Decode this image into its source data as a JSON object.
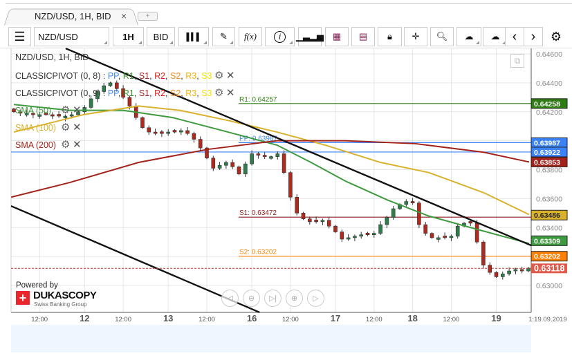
{
  "tab": {
    "title": "NZD/USD, 1H, BID",
    "close": "×",
    "new_tab": "+"
  },
  "toolbar": {
    "instrument": "NZD/USD",
    "period": "1H",
    "side": "BID",
    "fx": "f(x)",
    "info": "i"
  },
  "legend": {
    "title": "NZD/USD, 1H, BID",
    "pivots": [
      {
        "label": "CLASSICPIVOT (0, 8)"
      },
      {
        "label": "CLASSICPIVOT (0, 9)"
      }
    ],
    "pivot_levels": [
      {
        "t": "PP",
        "c": "#3b82f6"
      },
      {
        "t": "R1",
        "c": "#3a8a2a"
      },
      {
        "t": "S1",
        "c": "#b22222"
      },
      {
        "t": "R2",
        "c": "#e21b1b"
      },
      {
        "t": "S2",
        "c": "#f28a1a"
      },
      {
        "t": "R3",
        "c": "#f0b400"
      },
      {
        "t": "S3",
        "c": "#f4e200"
      }
    ],
    "smas": [
      {
        "label": "SMA (50)",
        "color": "#3e9a3e"
      },
      {
        "label": "SMA (100)",
        "color": "#d9b12b"
      },
      {
        "label": "SMA (200)",
        "color": "#a3231b"
      }
    ]
  },
  "branding": {
    "powered_by": "Powered by",
    "logo": "DUKASCOPY",
    "tagline": "Swiss Banking Group"
  },
  "chart_data": {
    "type": "candlestick",
    "title": "NZD/USD, 1H, BID",
    "ylim": [
      0.629,
      0.6465
    ],
    "y_ticks": [
      "0.64600",
      "0.64400",
      "0.64200",
      "0.64000",
      "0.63800",
      "0.63600",
      "0.63400",
      "0.63200",
      "0.63000"
    ],
    "y_tick_values": [
      0.646,
      0.644,
      0.642,
      0.64,
      0.638,
      0.636,
      0.634,
      0.632,
      0.63
    ],
    "x_ticks": [
      {
        "label": "12:00",
        "i": 4,
        "bold": false
      },
      {
        "label": "12",
        "i": 11,
        "bold": true
      },
      {
        "label": "12:00",
        "i": 17,
        "bold": false
      },
      {
        "label": "13",
        "i": 24,
        "bold": true
      },
      {
        "label": "12:00",
        "i": 30,
        "bold": false
      },
      {
        "label": "16",
        "i": 37,
        "bold": true
      },
      {
        "label": "12:00",
        "i": 43,
        "bold": false
      },
      {
        "label": "17",
        "i": 50,
        "bold": true
      },
      {
        "label": "12:00",
        "i": 56,
        "bold": false
      },
      {
        "label": "18",
        "i": 62,
        "bold": true
      },
      {
        "label": "12:00",
        "i": 68,
        "bold": false
      },
      {
        "label": "19",
        "i": 75,
        "bold": true
      }
    ],
    "x_end_label": "1:19.09.2019",
    "closes": [
      0.642,
      0.6419,
      0.6419,
      0.6418,
      0.6418,
      0.6418,
      0.6417,
      0.6417,
      0.6417,
      0.6418,
      0.642,
      0.6423,
      0.6429,
      0.6434,
      0.6438,
      0.644,
      0.6436,
      0.643,
      0.6424,
      0.6416,
      0.6409,
      0.6406,
      0.6405,
      0.6405,
      0.6406,
      0.6406,
      0.6407,
      0.6405,
      0.6401,
      0.6395,
      0.6388,
      0.6381,
      0.6383,
      0.6385,
      0.6382,
      0.6377,
      0.6384,
      0.6391,
      0.639,
      0.6389,
      0.6389,
      0.6391,
      0.6378,
      0.6361,
      0.635,
      0.6346,
      0.6344,
      0.6344,
      0.6345,
      0.6341,
      0.6337,
      0.6332,
      0.6333,
      0.6334,
      0.6335,
      0.6335,
      0.6336,
      0.6342,
      0.6347,
      0.6353,
      0.6356,
      0.6358,
      0.6357,
      0.6342,
      0.6336,
      0.6333,
      0.6333,
      0.6333,
      0.6334,
      0.6341,
      0.6343,
      0.6343,
      0.633,
      0.6314,
      0.6309,
      0.6306,
      0.6308,
      0.631,
      0.6311,
      0.631,
      0.6312
    ],
    "sma": [
      {
        "name": "SMA (50)",
        "color": "#3e9a3e",
        "points": [
          [
            0,
            0.6425
          ],
          [
            8.6,
            0.6421
          ],
          [
            17,
            0.6421
          ],
          [
            24.7,
            0.6416
          ],
          [
            33.3,
            0.6406
          ],
          [
            40.9,
            0.6397
          ],
          [
            46.2,
            0.6385
          ],
          [
            51.6,
            0.6372
          ],
          [
            58.1,
            0.6359
          ],
          [
            64.5,
            0.6348
          ],
          [
            71,
            0.634
          ],
          [
            80.1,
            0.6329
          ]
        ]
      },
      {
        "name": "SMA (100)",
        "color": "#d9b12b",
        "points": [
          [
            0,
            0.6406
          ],
          [
            10.8,
            0.6418
          ],
          [
            19.4,
            0.6424
          ],
          [
            25.8,
            0.6421
          ],
          [
            33.3,
            0.6414
          ],
          [
            40.9,
            0.6406
          ],
          [
            48.4,
            0.6397
          ],
          [
            57,
            0.6385
          ],
          [
            64.5,
            0.6378
          ],
          [
            73.1,
            0.6364
          ],
          [
            80.1,
            0.6349
          ]
        ]
      },
      {
        "name": "SMA (200)",
        "color": "#a3231b",
        "points": [
          [
            -0.4,
            0.6361
          ],
          [
            8.6,
            0.6371
          ],
          [
            19.4,
            0.6385
          ],
          [
            30.1,
            0.6394
          ],
          [
            40.9,
            0.64
          ],
          [
            51.6,
            0.64
          ],
          [
            62.4,
            0.6398
          ],
          [
            73.1,
            0.6392
          ],
          [
            80.1,
            0.63853
          ]
        ]
      }
    ],
    "trendlines": [
      [
        [
          8.06,
          0.64638
        ],
        [
          80.4,
          0.63277
        ]
      ],
      [
        [
          -0.43,
          0.63549
        ],
        [
          38.2,
          0.62814
        ]
      ]
    ],
    "levels": [
      {
        "label": "R1: 0.64257",
        "value": 0.64257,
        "tag": "0.64258",
        "color": "#2e7d12",
        "from_label": true
      },
      {
        "label": "PP: 0.63987",
        "value": 0.63987,
        "tag": "0.63987",
        "color": "#3b82f6",
        "from_label": true
      },
      {
        "label": "",
        "value": 0.63922,
        "tag": "0.63922",
        "color": "#3b82f6",
        "from_label": false
      },
      {
        "label": "S1: 0.63472",
        "value": 0.63472,
        "tag": "0.63486",
        "color": "#8b1a1a",
        "tag_color": "#d9b12b",
        "tag_text": "#222",
        "from_label": true
      },
      {
        "label": "S2: 0.63202",
        "value": 0.63202,
        "tag": "0.63202",
        "color": "#ff8000",
        "from_label": true
      }
    ],
    "sma_tags": [
      {
        "value": 0.63853,
        "tag": "0.63853",
        "color": "#a3231b"
      },
      {
        "value": 0.63309,
        "tag": "0.63309",
        "color": "#3e9a3e"
      }
    ],
    "current_price": {
      "value": 0.63118,
      "tag": "0.63118",
      "color": "#e0594a"
    }
  }
}
